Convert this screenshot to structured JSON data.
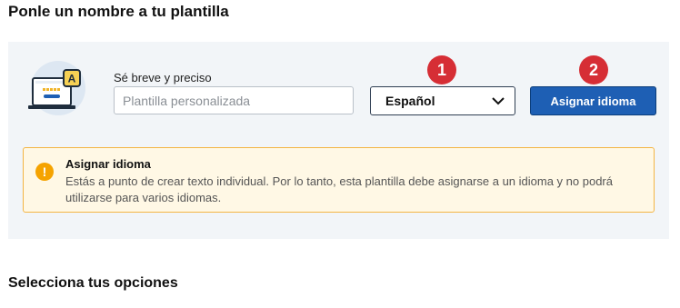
{
  "page": {
    "title": "Ponle un nombre a tu plantilla",
    "options_title": "Selecciona tus opciones"
  },
  "template_name": {
    "label": "Sé breve y preciso",
    "placeholder": "Plantilla personalizada",
    "value": ""
  },
  "language_select": {
    "selected": "Español",
    "icon": "chevron-down-icon"
  },
  "assign_button": {
    "label": "Asignar idioma"
  },
  "step_badges": [
    "1",
    "2"
  ],
  "warning": {
    "icon": "exclamation-icon",
    "title": "Asignar idioma",
    "text": "Estás a punto de crear texto individual. Por lo tanto, esta plantilla debe asignarse a un idioma y no podrá utilizarse para varios idiomas."
  },
  "illustration": {
    "badge_letter": "A"
  },
  "colors": {
    "accent": "#1e5fb4",
    "badge": "#d62e35",
    "warning_border": "#f3b544",
    "warning_bg": "#fff8e5",
    "panel_bg": "#f2f5f8"
  }
}
